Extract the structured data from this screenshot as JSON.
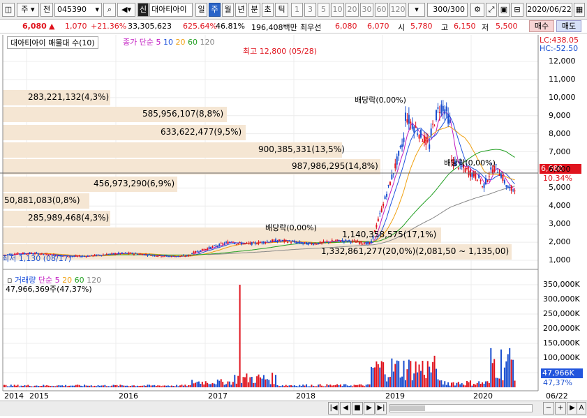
{
  "toolbar": {
    "market": "주",
    "prefix": "전",
    "code": "045390",
    "badge": "신",
    "name": "대아티아이",
    "periods": [
      "일",
      "주",
      "월",
      "년",
      "분",
      "초",
      "틱"
    ],
    "selected_period": "주",
    "numbers": [
      "1",
      "3",
      "5",
      "10",
      "20",
      "30",
      "60",
      "120"
    ],
    "count": "300/300",
    "date": "2020/06/22"
  },
  "quote": {
    "price": "6,080",
    "change": "1,070",
    "change_pct": "+21.36%",
    "volume": "33,305,623",
    "volume_ratio": "625.64%",
    "ratio2": "46.81%",
    "amount": "196,408백만",
    "best_ask_label": "최우선",
    "best_ask": "6,080",
    "best_bid": "6,070",
    "open_label": "시",
    "open": "5,780",
    "high_label": "고",
    "high": "6,150",
    "low_label": "저",
    "low": "5,500",
    "buy_button": "매수",
    "sell_button": "매도"
  },
  "price_panel": {
    "title": "대아티아이 매물대 수(10)",
    "ma_label": "종가 단순",
    "ma_periods": [
      "5",
      "10",
      "20",
      "60",
      "120"
    ],
    "lc": "LC:438.05",
    "hc": "HC:-52.50",
    "high_note": "최고 12,800 (05/28)",
    "low_note": "최저 1,130 (08/17)",
    "current_price": "6,080",
    "current_pct": "10.34%",
    "y_ticks": [
      "12,000",
      "11,000",
      "10,000",
      "9,000",
      "8,000",
      "7,000",
      "6,000",
      "5,000",
      "4,000",
      "3,000",
      "2,000",
      "1,000"
    ],
    "dividend_notes": [
      "배당락(0,00%)",
      "배당락(0,00%)",
      "배당락(0,00%)"
    ],
    "volume_profile": [
      {
        "label": "283,221,132(4,3%)"
      },
      {
        "label": "585,956,107(8,8%)"
      },
      {
        "label": "633,622,477(9,5%)"
      },
      {
        "label": "900,385,331(13,5%)"
      },
      {
        "label": "987,986,295(14,8%)"
      },
      {
        "label": "456,973,290(6,9%)"
      },
      {
        "label": "50,881,083(0,8%)"
      },
      {
        "label": "285,989,468(4,3%)"
      },
      {
        "label": "1,140,358,575(17,1%)"
      },
      {
        "label": "1,332,861,277(20,0%)(2,081,50 ~ 1,135,00)"
      }
    ]
  },
  "volume_panel": {
    "title": "거래량",
    "ma_label": "단순",
    "ma_periods": [
      "5",
      "20",
      "60",
      "120"
    ],
    "stat": "47,966,369주(47,37%)",
    "y_ticks": [
      "350,000K",
      "300,000K",
      "250,000K",
      "200,000K",
      "150,000K",
      "100,000K",
      "50,000K"
    ],
    "current": "47,966K",
    "current_pct": "47,37%"
  },
  "x_axis": {
    "labels": [
      "2014",
      "2015",
      "2016",
      "2017",
      "2018",
      "2019",
      "2020",
      "06/22"
    ]
  },
  "colors": {
    "up": "#e0141e",
    "down": "#1a4fd0",
    "profile": "#f5e6d3",
    "ma5": "#c21cc2",
    "ma10": "#2255dd",
    "ma20": "#f0a010",
    "ma60": "#23a023",
    "ma120": "#888888"
  }
}
